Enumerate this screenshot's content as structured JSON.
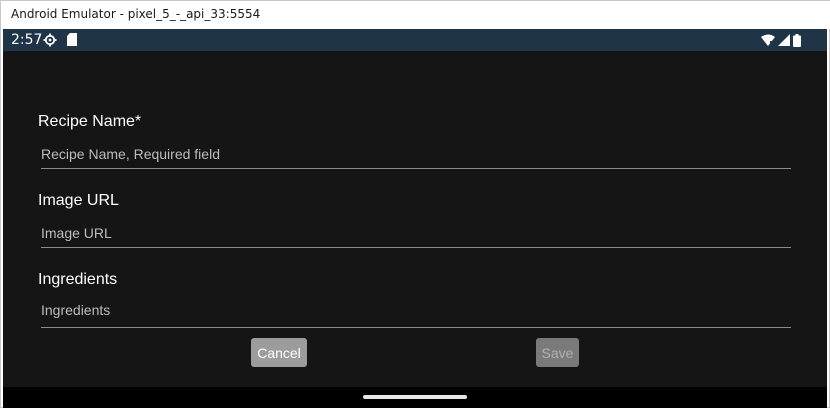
{
  "window": {
    "title": "Android Emulator - pixel_5_-_api_33:5554"
  },
  "status_bar": {
    "time": "2:57",
    "left_icons": [
      "settings-gear-icon",
      "sd-card-icon"
    ],
    "right_icons": [
      "wifi-icon",
      "signal-icon",
      "battery-icon"
    ]
  },
  "form": {
    "recipe_name": {
      "label": "Recipe Name*",
      "placeholder": "Recipe Name, Required field",
      "value": ""
    },
    "image_url": {
      "label": "Image URL",
      "placeholder": "Image URL",
      "value": ""
    },
    "ingredients": {
      "label": "Ingredients",
      "placeholder": "Ingredients",
      "value": ""
    }
  },
  "actions": {
    "cancel_label": "Cancel",
    "save_label": "Save",
    "save_enabled": false
  },
  "colors": {
    "status_bar": "#1f3447",
    "background": "#151515",
    "button_cancel": "#9c9c9c",
    "button_save_disabled": "#7a7a7a"
  }
}
